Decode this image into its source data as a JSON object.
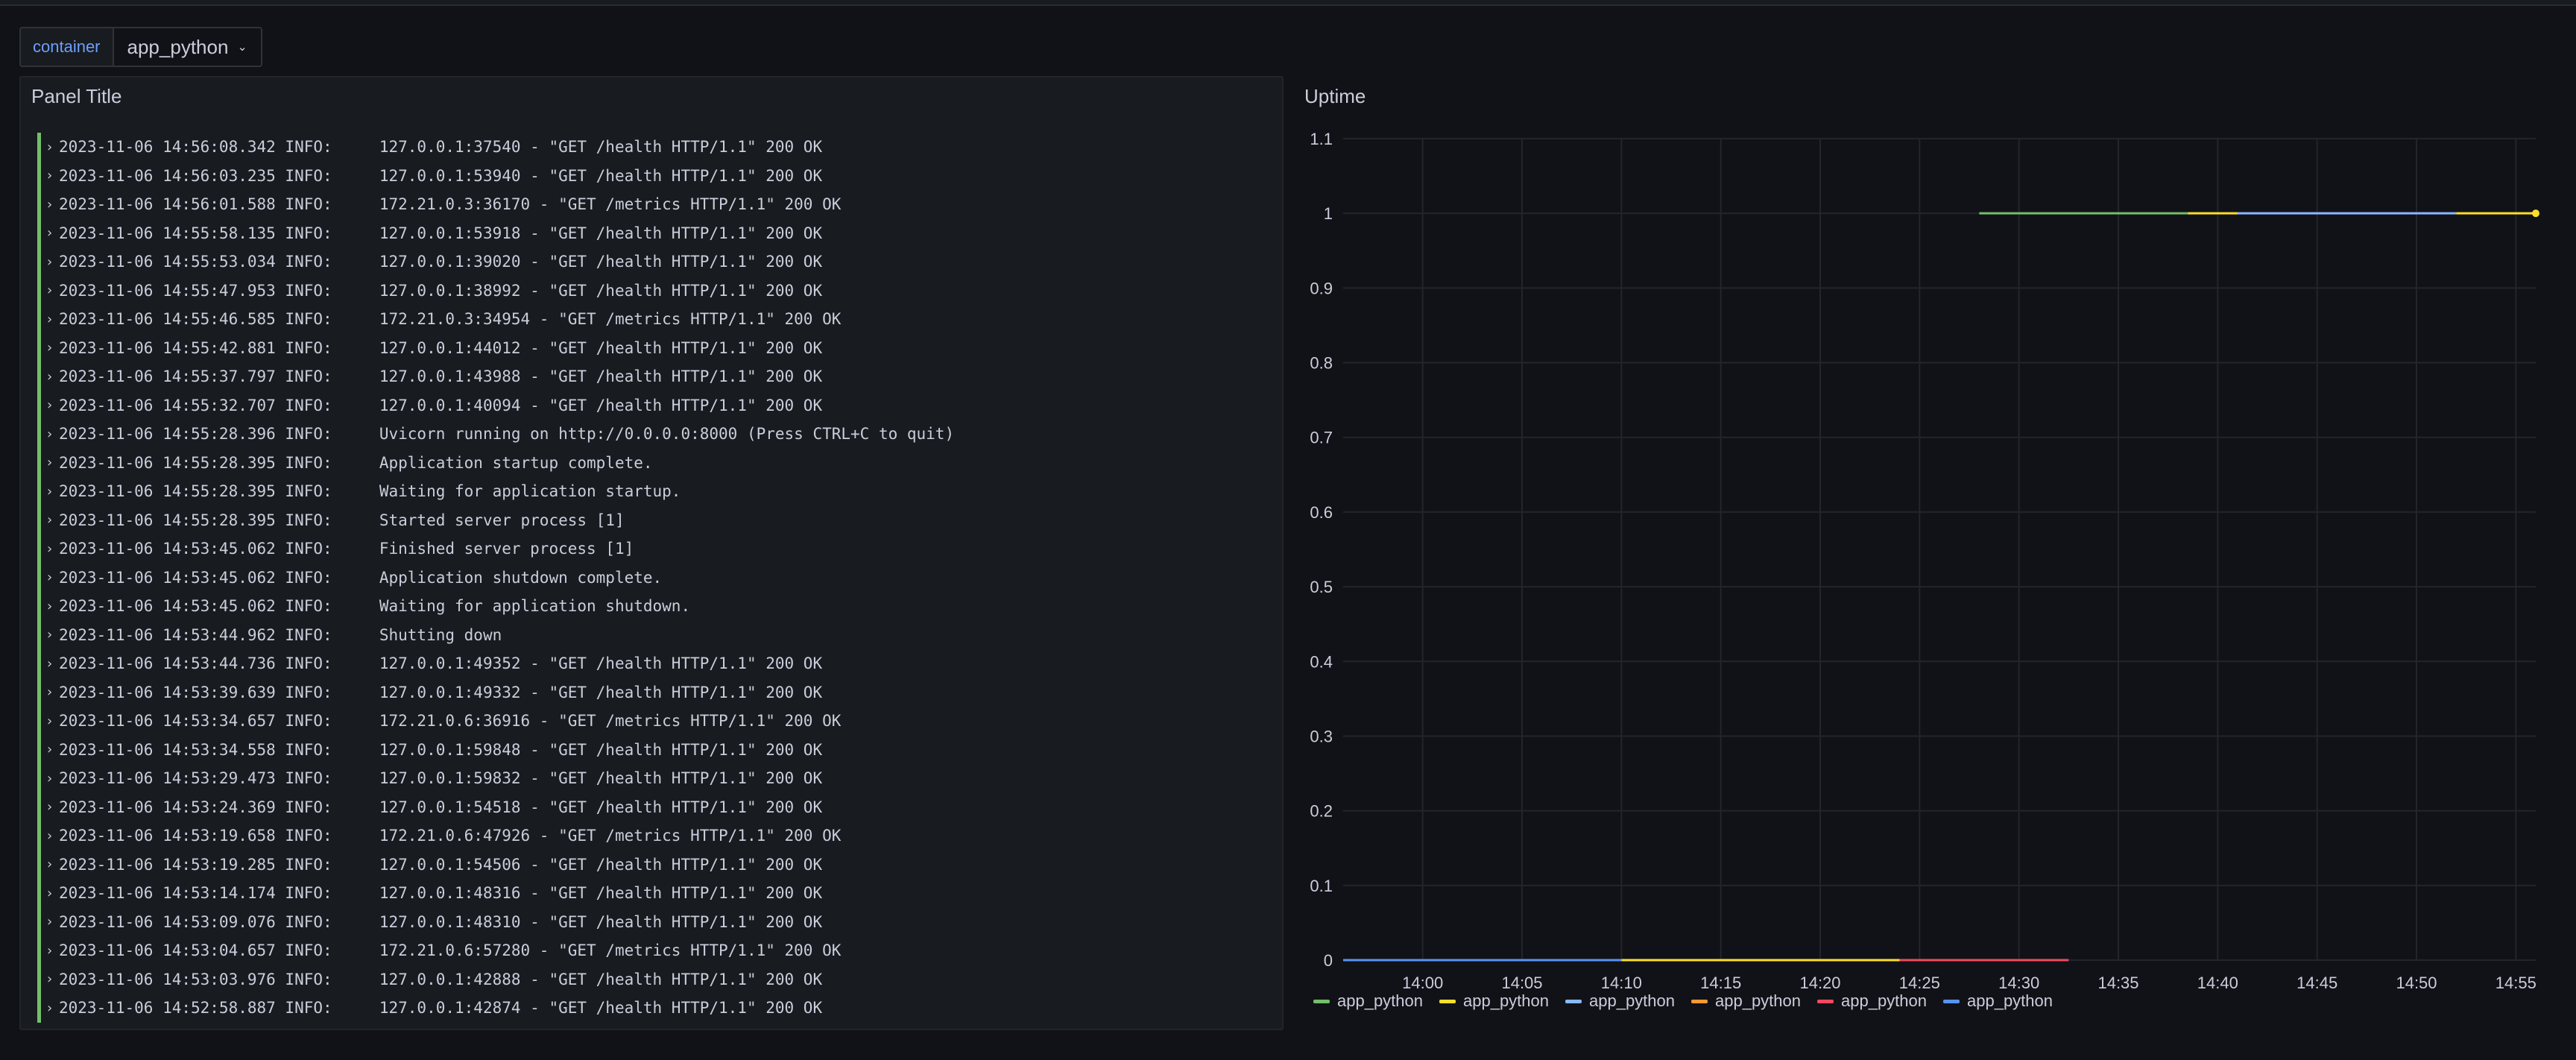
{
  "variable": {
    "label": "container",
    "value": "app_python"
  },
  "logs_panel": {
    "title": "Panel Title",
    "rows": [
      "2023-11-06 14:56:08.342 INFO:     127.0.0.1:37540 - \"GET /health HTTP/1.1\" 200 OK",
      "2023-11-06 14:56:03.235 INFO:     127.0.0.1:53940 - \"GET /health HTTP/1.1\" 200 OK",
      "2023-11-06 14:56:01.588 INFO:     172.21.0.3:36170 - \"GET /metrics HTTP/1.1\" 200 OK",
      "2023-11-06 14:55:58.135 INFO:     127.0.0.1:53918 - \"GET /health HTTP/1.1\" 200 OK",
      "2023-11-06 14:55:53.034 INFO:     127.0.0.1:39020 - \"GET /health HTTP/1.1\" 200 OK",
      "2023-11-06 14:55:47.953 INFO:     127.0.0.1:38992 - \"GET /health HTTP/1.1\" 200 OK",
      "2023-11-06 14:55:46.585 INFO:     172.21.0.3:34954 - \"GET /metrics HTTP/1.1\" 200 OK",
      "2023-11-06 14:55:42.881 INFO:     127.0.0.1:44012 - \"GET /health HTTP/1.1\" 200 OK",
      "2023-11-06 14:55:37.797 INFO:     127.0.0.1:43988 - \"GET /health HTTP/1.1\" 200 OK",
      "2023-11-06 14:55:32.707 INFO:     127.0.0.1:40094 - \"GET /health HTTP/1.1\" 200 OK",
      "2023-11-06 14:55:28.396 INFO:     Uvicorn running on http://0.0.0.0:8000 (Press CTRL+C to quit)",
      "2023-11-06 14:55:28.395 INFO:     Application startup complete.",
      "2023-11-06 14:55:28.395 INFO:     Waiting for application startup.",
      "2023-11-06 14:55:28.395 INFO:     Started server process [1]",
      "2023-11-06 14:53:45.062 INFO:     Finished server process [1]",
      "2023-11-06 14:53:45.062 INFO:     Application shutdown complete.",
      "2023-11-06 14:53:45.062 INFO:     Waiting for application shutdown.",
      "2023-11-06 14:53:44.962 INFO:     Shutting down",
      "2023-11-06 14:53:44.736 INFO:     127.0.0.1:49352 - \"GET /health HTTP/1.1\" 200 OK",
      "2023-11-06 14:53:39.639 INFO:     127.0.0.1:49332 - \"GET /health HTTP/1.1\" 200 OK",
      "2023-11-06 14:53:34.657 INFO:     172.21.0.6:36916 - \"GET /metrics HTTP/1.1\" 200 OK",
      "2023-11-06 14:53:34.558 INFO:     127.0.0.1:59848 - \"GET /health HTTP/1.1\" 200 OK",
      "2023-11-06 14:53:29.473 INFO:     127.0.0.1:59832 - \"GET /health HTTP/1.1\" 200 OK",
      "2023-11-06 14:53:24.369 INFO:     127.0.0.1:54518 - \"GET /health HTTP/1.1\" 200 OK",
      "2023-11-06 14:53:19.658 INFO:     172.21.0.6:47926 - \"GET /metrics HTTP/1.1\" 200 OK",
      "2023-11-06 14:53:19.285 INFO:     127.0.0.1:54506 - \"GET /health HTTP/1.1\" 200 OK",
      "2023-11-06 14:53:14.174 INFO:     127.0.0.1:48316 - \"GET /health HTTP/1.1\" 200 OK",
      "2023-11-06 14:53:09.076 INFO:     127.0.0.1:48310 - \"GET /health HTTP/1.1\" 200 OK",
      "2023-11-06 14:53:04.657 INFO:     172.21.0.6:57280 - \"GET /metrics HTTP/1.1\" 200 OK",
      "2023-11-06 14:53:03.976 INFO:     127.0.0.1:42888 - \"GET /health HTTP/1.1\" 200 OK",
      "2023-11-06 14:52:58.887 INFO:     127.0.0.1:42874 - \"GET /health HTTP/1.1\" 200 OK"
    ],
    "level_color": "#73bf69"
  },
  "chart_data": {
    "type": "line",
    "title": "Uptime",
    "xlabel": "",
    "ylabel": "",
    "xlim": [
      "13:56",
      "14:56"
    ],
    "ylim": [
      0,
      1.1
    ],
    "yticks": [
      0,
      0.1,
      0.2,
      0.3,
      0.4,
      0.5,
      0.6,
      0.7,
      0.8,
      0.9,
      1,
      1.1
    ],
    "xticks": [
      "14:00",
      "14:05",
      "14:10",
      "14:15",
      "14:20",
      "14:25",
      "14:30",
      "14:35",
      "14:40",
      "14:45",
      "14:50",
      "14:55"
    ],
    "grid": true,
    "legend_position": "bottom-left",
    "series": [
      {
        "name": "app_python",
        "color": "#73bf69",
        "x": [
          "14:28",
          "14:38.5"
        ],
        "y": [
          1,
          1
        ]
      },
      {
        "name": "app_python",
        "color": "#fade2a",
        "x": [
          "14:38.5",
          "14:41"
        ],
        "y": [
          1,
          1
        ]
      },
      {
        "name": "app_python",
        "color": "#8ab8ff",
        "x": [
          "14:41",
          "14:52"
        ],
        "y": [
          1,
          1
        ]
      },
      {
        "name": "app_python",
        "color": "#fade2a",
        "x": [
          "14:52",
          "14:56"
        ],
        "y": [
          1,
          1
        ]
      },
      {
        "name": "app_python",
        "color": "#5794f2",
        "x": [
          "13:56",
          "14:10"
        ],
        "y": [
          0,
          0
        ]
      },
      {
        "name": "app_python",
        "color": "#fade2a",
        "x": [
          "14:10",
          "14:24"
        ],
        "y": [
          0,
          0
        ]
      },
      {
        "name": "app_python",
        "color": "#f2495c",
        "x": [
          "14:24",
          "14:32.5"
        ],
        "y": [
          0,
          0
        ]
      }
    ],
    "legend": [
      {
        "name": "app_python",
        "color": "#73bf69"
      },
      {
        "name": "app_python",
        "color": "#fade2a"
      },
      {
        "name": "app_python",
        "color": "#8ab8ff"
      },
      {
        "name": "app_python",
        "color": "#ff9830"
      },
      {
        "name": "app_python",
        "color": "#f2495c"
      },
      {
        "name": "app_python",
        "color": "#5794f2"
      }
    ]
  }
}
